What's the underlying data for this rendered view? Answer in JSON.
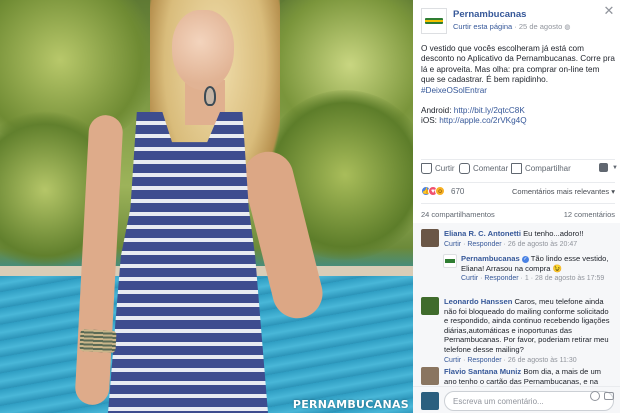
{
  "photo": {
    "watermark": "PERNAMBUCANAS"
  },
  "post": {
    "page_name": "Pernambucanas",
    "follow_label": "Curtir esta página",
    "separator": "·",
    "date": "25 de agosto",
    "paragraph1": "O vestido que vocês escolheram já está com desconto no Aplicativo da Pernambucanas. Corre pra lá e aproveita. Mas olha: pra comprar on-line tem que se cadastrar. É bem rapidinho.",
    "hashtag": "#DeixeOSolEntrar",
    "android_label": "Android:",
    "android_link": "http://bit.ly/2qtcC8K",
    "ios_label": "iOS:",
    "ios_link": "http://apple.co/2rVKg4Q"
  },
  "actions": {
    "like": "Curtir",
    "comment": "Comentar",
    "share": "Compartilhar",
    "viewer_icon": "profile-picture-icon"
  },
  "reactions": {
    "icons": [
      "like",
      "love",
      "wow"
    ],
    "count": "670",
    "sort_label": "Comentários mais relevantes ▾"
  },
  "counts": {
    "shares": "24 compartilhamentos",
    "comments": "12 comentários"
  },
  "comments": [
    {
      "name": "Eliana R. C. Antonetti",
      "text": "Eu tenho...adoro!!",
      "like": "Curtir",
      "reply": "Responder",
      "date": "26 de agosto às 20:47",
      "avatar_color": "#6a5646"
    },
    {
      "name": "Pernambucanas",
      "text": "Tão lindo esse vestido, Eliana! Arrasou na compra 😉",
      "like": "Curtir",
      "reply": "Responder",
      "count": "1",
      "date": "28 de agosto às 17:59"
    },
    {
      "name": "Leonardo Hanssen",
      "text": "Caros, meu telefone ainda não foi bloqueado do mailing conforme solicitado e respondido, ainda continuo recebendo ligações diárias,automáticas e inoportunas das Pernambucanas. Por favor, poderiam retirar meu telefone desse mailing?",
      "like": "Curtir",
      "reply": "Responder",
      "date": "26 de agosto às 11:30",
      "avatar_color": "#3f6b2c"
    },
    {
      "name": "Flavio Santana Muniz",
      "text": "Bom dia, a mais de um ano tenho o cartão das Pernambucanas, e na época da",
      "avatar_color": "#8a7560"
    }
  ],
  "composer": {
    "placeholder": "Escreva um comentário..."
  },
  "close_label": "✕"
}
